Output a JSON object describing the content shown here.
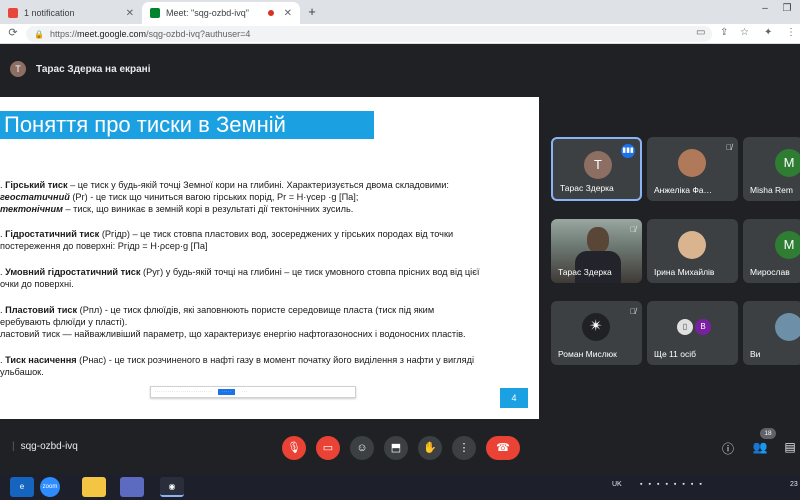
{
  "browser": {
    "tabs": [
      {
        "title": "1 notification"
      },
      {
        "title": "Meet: \"sqg-ozbd-ivq\""
      }
    ],
    "new_tab": "+",
    "minimize": "–",
    "url": {
      "host": "meet.google.com",
      "rest": "/sqg-ozbd-ivq?authuser=4",
      "prefix": "https://"
    }
  },
  "meet": {
    "presenter_initial": "T",
    "presenter_text": "Тарас Здерка на екрані",
    "meeting_code": "sqg-ozbd-ivq",
    "participant_count": "18"
  },
  "slide": {
    "title": "Поняття про тиски в Земній",
    "p1_line1_num": ".",
    "p1_line1_term": "Гірський тиск",
    "p1_line1_rest": " – це тиск у будь-якій точці Земної кори на глибині. Характеризується двома складовими:",
    "p1_line2_term": "геостатичний",
    "p1_line2_rest": " (Pr) - це тиск що чиниться вагою гірських порід,   Pr = H·γсер ·g  [Па];",
    "p1_line3_term": "тектонічним",
    "p1_line3_rest": " – тиск, що виникає в земній корі в результаті дії тектонічних зусиль.",
    "p2_line1_term": "Гідростатичний тиск",
    "p2_line1_rest": " (Pгідр) – це тиск стовпа пластових вод, зосереджених у гірських породах від точки",
    "p2_line2": "постереження до поверхні:    Pгідр = H·ρсер·g [Па]",
    "p3_line1_term": "Умовний гідростатичний тиск",
    "p3_line1_rest": " (Pуг) у будь-якій точці на глибині – це тиск умовного стовпа прісних вод від цієї",
    "p3_line2": "очки до поверхні.",
    "p4_line1_term": "Пластовий тиск",
    "p4_line1_rest": " (Pпл) - це тиск флюїдів, які заповнюють пористе середовище пласта (тиск під яким",
    "p4_line2": "еребувають флюїди у пласті).",
    "p4_line3": "ластовий тиск — найважливіший параметр, що характеризує енергію нафтогазоносних і водоносних пластів.",
    "p5_line1_term": "Тиск насичення",
    "p5_line1_rest": " (Pнас) - це тиск розчиненого в нафті газу в момент початку його виділення з нафти у вигляді",
    "p5_line2": "ульбашок.",
    "page_number": "4"
  },
  "participants": [
    {
      "name": "Тарас Здерка",
      "initial": "T",
      "color": "#8d6e63"
    },
    {
      "name": "Анжеліка Фа…"
    },
    {
      "name": "Misha Rem",
      "initial": "M",
      "color": "#2e7d32"
    },
    {
      "name": "Тарас Здерка"
    },
    {
      "name": "Ірина Михайлів"
    },
    {
      "name": "Мирослав",
      "initial": "M",
      "color": "#2e7d32"
    },
    {
      "name": "Роман Мислюк"
    },
    {
      "name": "Ще 11 осіб",
      "initial": "B",
      "color": "#7b1fa2"
    },
    {
      "name": "Ви"
    }
  ],
  "taskbar": {
    "lang": "UK",
    "time_fragment": "23"
  },
  "colors": {
    "meet_bg": "#202124",
    "tile_bg": "#3c4043",
    "slide_accent": "#1ba1e2",
    "hangup_red": "#ea4335"
  }
}
